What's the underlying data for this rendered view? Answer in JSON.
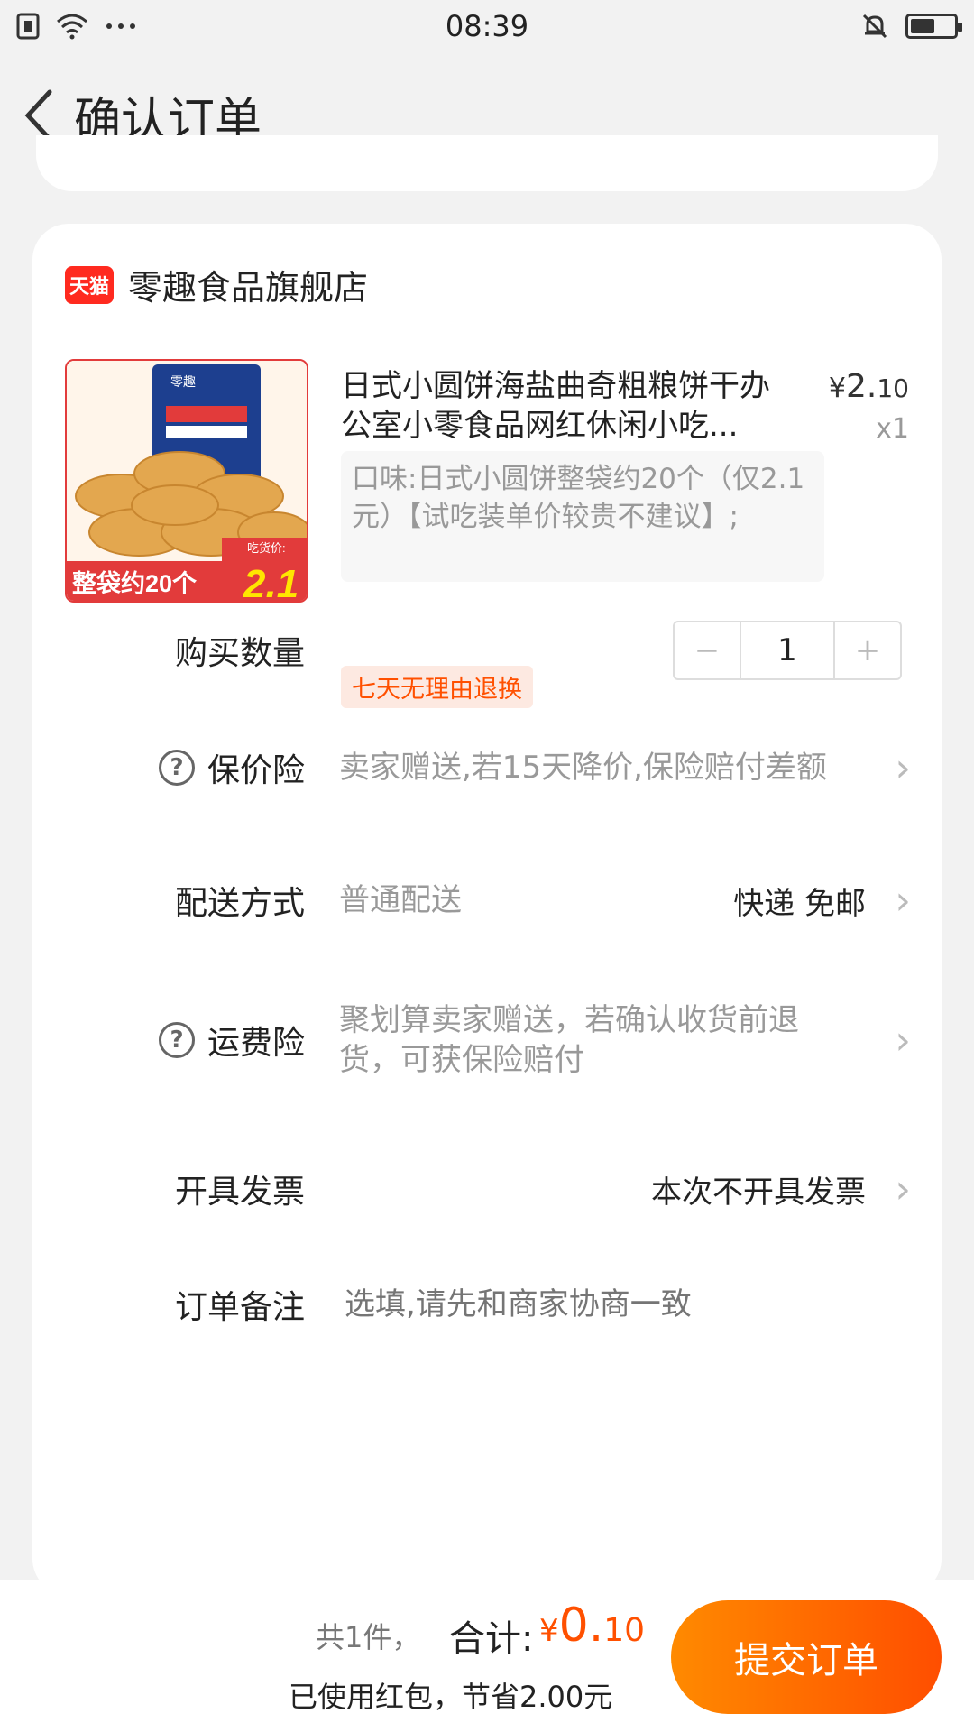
{
  "status": {
    "time": "08:39"
  },
  "header": {
    "title": "确认订单"
  },
  "store": {
    "badge": "天猫",
    "name": "零趣食品旗舰店"
  },
  "product": {
    "title": "日式小圆饼海盐曲奇粗粮饼干办公室小零食品网红休闲小吃...",
    "price_currency": "¥",
    "price_int": "2.",
    "price_dec": "10",
    "quantity_label": "x1",
    "spec": "口味:日式小圆饼整袋约20个（仅2.1元）【试吃装单价较贵不建议】;",
    "tag": "七天无理由退换",
    "image_text": {
      "brand": "零趣",
      "banner": "整袋约20个",
      "price_tag": "吃货价:",
      "price": "2.1"
    }
  },
  "rows": {
    "quantity": {
      "label": "购买数量",
      "value": "1",
      "minus": "−",
      "plus": "+"
    },
    "price_protect": {
      "label": "保价险",
      "value": "卖家赠送,若15天降价,保险赔付差额"
    },
    "delivery": {
      "label": "配送方式",
      "value": "普通配送",
      "right": "快递 免邮"
    },
    "freight_insurance": {
      "label": "运费险",
      "value": "聚划算卖家赠送，若确认收货前退货，可获保险赔付"
    },
    "invoice": {
      "label": "开具发票",
      "right": "本次不开具发票"
    },
    "note": {
      "label": "订单备注",
      "placeholder": "选填,请先和商家协商一致"
    }
  },
  "footer": {
    "count": "共1件，",
    "total_label": "合计:",
    "total_currency": "¥",
    "total_int": "0.",
    "total_dec": "10",
    "savings": "已使用红包，节省2.00元",
    "submit_label": "提交订单"
  },
  "colors": {
    "accent": "#ff5000",
    "tmall_red": "#ff2a1f"
  }
}
